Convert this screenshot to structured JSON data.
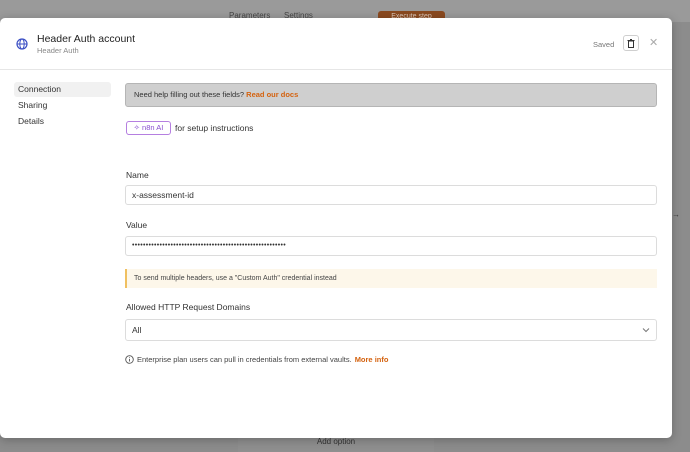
{
  "background": {
    "tabs": [
      "Parameters",
      "Settings"
    ],
    "execute_label": "Execute step",
    "bottom_button": "Add option"
  },
  "modal": {
    "title": "Header Auth account",
    "subtitle": "Header Auth",
    "saved_label": "Saved",
    "sidebar": [
      "Connection",
      "Sharing",
      "Details"
    ],
    "help": {
      "text": "Need help filling out these fields?",
      "link": "Read our docs"
    },
    "ai_button": "n8n AI",
    "ai_suffix": "for setup instructions",
    "name": {
      "label": "Name",
      "value": "x-assessment-id"
    },
    "value": {
      "label": "Value",
      "masked": "••••••••••••••••••••••••••••••••••••••••••••••••••••••••"
    },
    "notice": "To send multiple headers, use a \"Custom Auth\" credential instead",
    "domains": {
      "label": "Allowed HTTP Request Domains",
      "selected": "All"
    },
    "enterprise": {
      "text": "Enterprise plan users can pull in credentials from external vaults.",
      "link": "More info"
    }
  }
}
